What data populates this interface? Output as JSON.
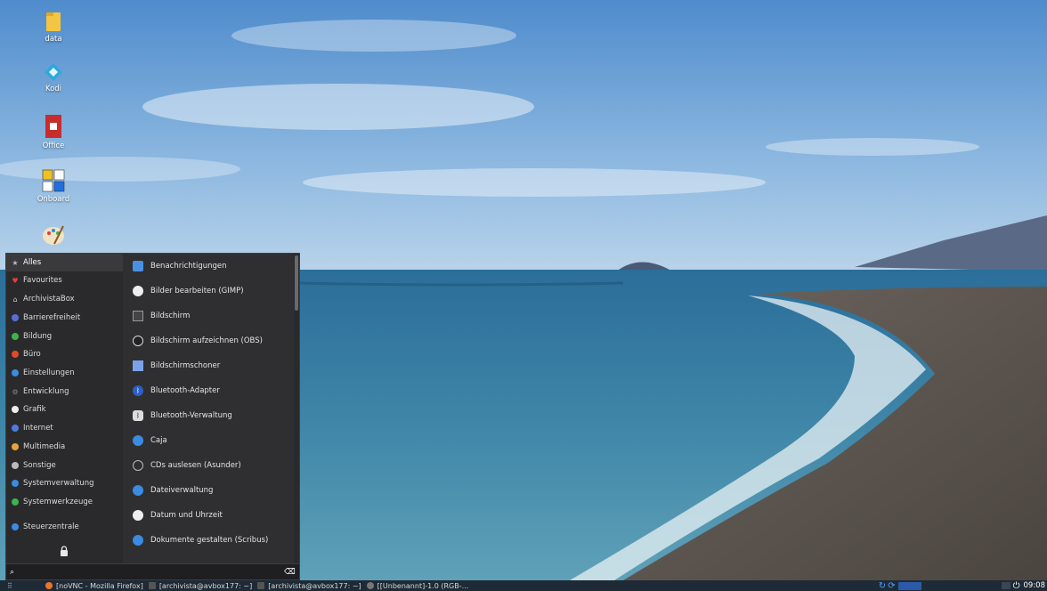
{
  "desktop": {
    "icons": [
      {
        "label": "data",
        "icon": "folder-icon"
      },
      {
        "label": "Kodi",
        "icon": "kodi-icon"
      },
      {
        "label": "Office",
        "icon": "office-icon"
      },
      {
        "label": "Onboard",
        "icon": "onboard-keyboard-icon"
      },
      {
        "label": "",
        "icon": "paint-palette-icon"
      }
    ]
  },
  "menu": {
    "categories": [
      {
        "label": "Alles",
        "icon": "star-icon",
        "color": "#bbbbbb",
        "active": true
      },
      {
        "label": "Favourites",
        "icon": "heart-icon",
        "color": "#e04040"
      },
      {
        "label": "ArchivistaBox",
        "icon": "home-icon",
        "color": "#cccccc"
      },
      {
        "label": "Barrierefreiheit",
        "icon": "accessibility-icon",
        "color": "#5b6cd9"
      },
      {
        "label": "Bildung",
        "icon": "education-icon",
        "color": "#3cb44b"
      },
      {
        "label": "Büro",
        "icon": "office-icon",
        "color": "#e04a2a"
      },
      {
        "label": "Einstellungen",
        "icon": "settings-icon",
        "color": "#3b8be0"
      },
      {
        "label": "Entwicklung",
        "icon": "gear-icon",
        "color": "#888888"
      },
      {
        "label": "Grafik",
        "icon": "graphics-icon",
        "color": "#eeeeee"
      },
      {
        "label": "Internet",
        "icon": "globe-icon",
        "color": "#4f7be0"
      },
      {
        "label": "Multimedia",
        "icon": "multimedia-icon",
        "color": "#e8a23a"
      },
      {
        "label": "Sonstige",
        "icon": "misc-icon",
        "color": "#bbbbbb"
      },
      {
        "label": "Systemverwaltung",
        "icon": "system-admin-icon",
        "color": "#3b8be0"
      },
      {
        "label": "Systemwerkzeuge",
        "icon": "system-tools-icon",
        "color": "#3cb44b"
      },
      {
        "label": "Steuerzentrale",
        "icon": "control-center-icon",
        "color": "#3b8be0"
      }
    ],
    "apps": [
      {
        "label": "Benachrichtigungen",
        "icon": "notifications-icon",
        "color": "#4a90e2"
      },
      {
        "label": "Bilder bearbeiten (GIMP)",
        "icon": "gimp-icon",
        "color": "#eeeeee"
      },
      {
        "label": "Bildschirm",
        "icon": "display-icon",
        "color": "#444444"
      },
      {
        "label": "Bildschirm aufzeichnen (OBS)",
        "icon": "obs-icon",
        "color": "#222222"
      },
      {
        "label": "Bildschirmschoner",
        "icon": "screensaver-icon",
        "color": "#7aa2e8"
      },
      {
        "label": "Bluetooth-Adapter",
        "icon": "bluetooth-icon",
        "color": "#2d5fc4"
      },
      {
        "label": "Bluetooth-Verwaltung",
        "icon": "bluetooth-manager-icon",
        "color": "#dddddd"
      },
      {
        "label": "Caja",
        "icon": "caja-icon",
        "color": "#3b8be0"
      },
      {
        "label": "CDs auslesen (Asunder)",
        "icon": "cd-icon",
        "color": "#bbbbbb"
      },
      {
        "label": "Dateiverwaltung",
        "icon": "file-manager-icon",
        "color": "#3b8be0"
      },
      {
        "label": "Datum und Uhrzeit",
        "icon": "clock-icon",
        "color": "#eeeeee"
      },
      {
        "label": "Dokumente gestalten (Scribus)",
        "icon": "scribus-icon",
        "color": "#3b8be0"
      }
    ],
    "search": {
      "value": "",
      "placeholder": ""
    }
  },
  "taskbar": {
    "windows": [
      {
        "label": "[noVNC - Mozilla Firefox]",
        "icon": "firefox-icon",
        "color": "#e8762b"
      },
      {
        "label": "[archivista@avbox177: ~]",
        "icon": "terminal-icon",
        "color": "#555555"
      },
      {
        "label": "[archivista@avbox177: ~]",
        "icon": "terminal-icon",
        "color": "#555555"
      },
      {
        "label": "[[Unbenannt]-1.0 (RGB-...",
        "icon": "gimp-window-icon",
        "color": "#777777"
      }
    ],
    "clock": "09:08"
  }
}
